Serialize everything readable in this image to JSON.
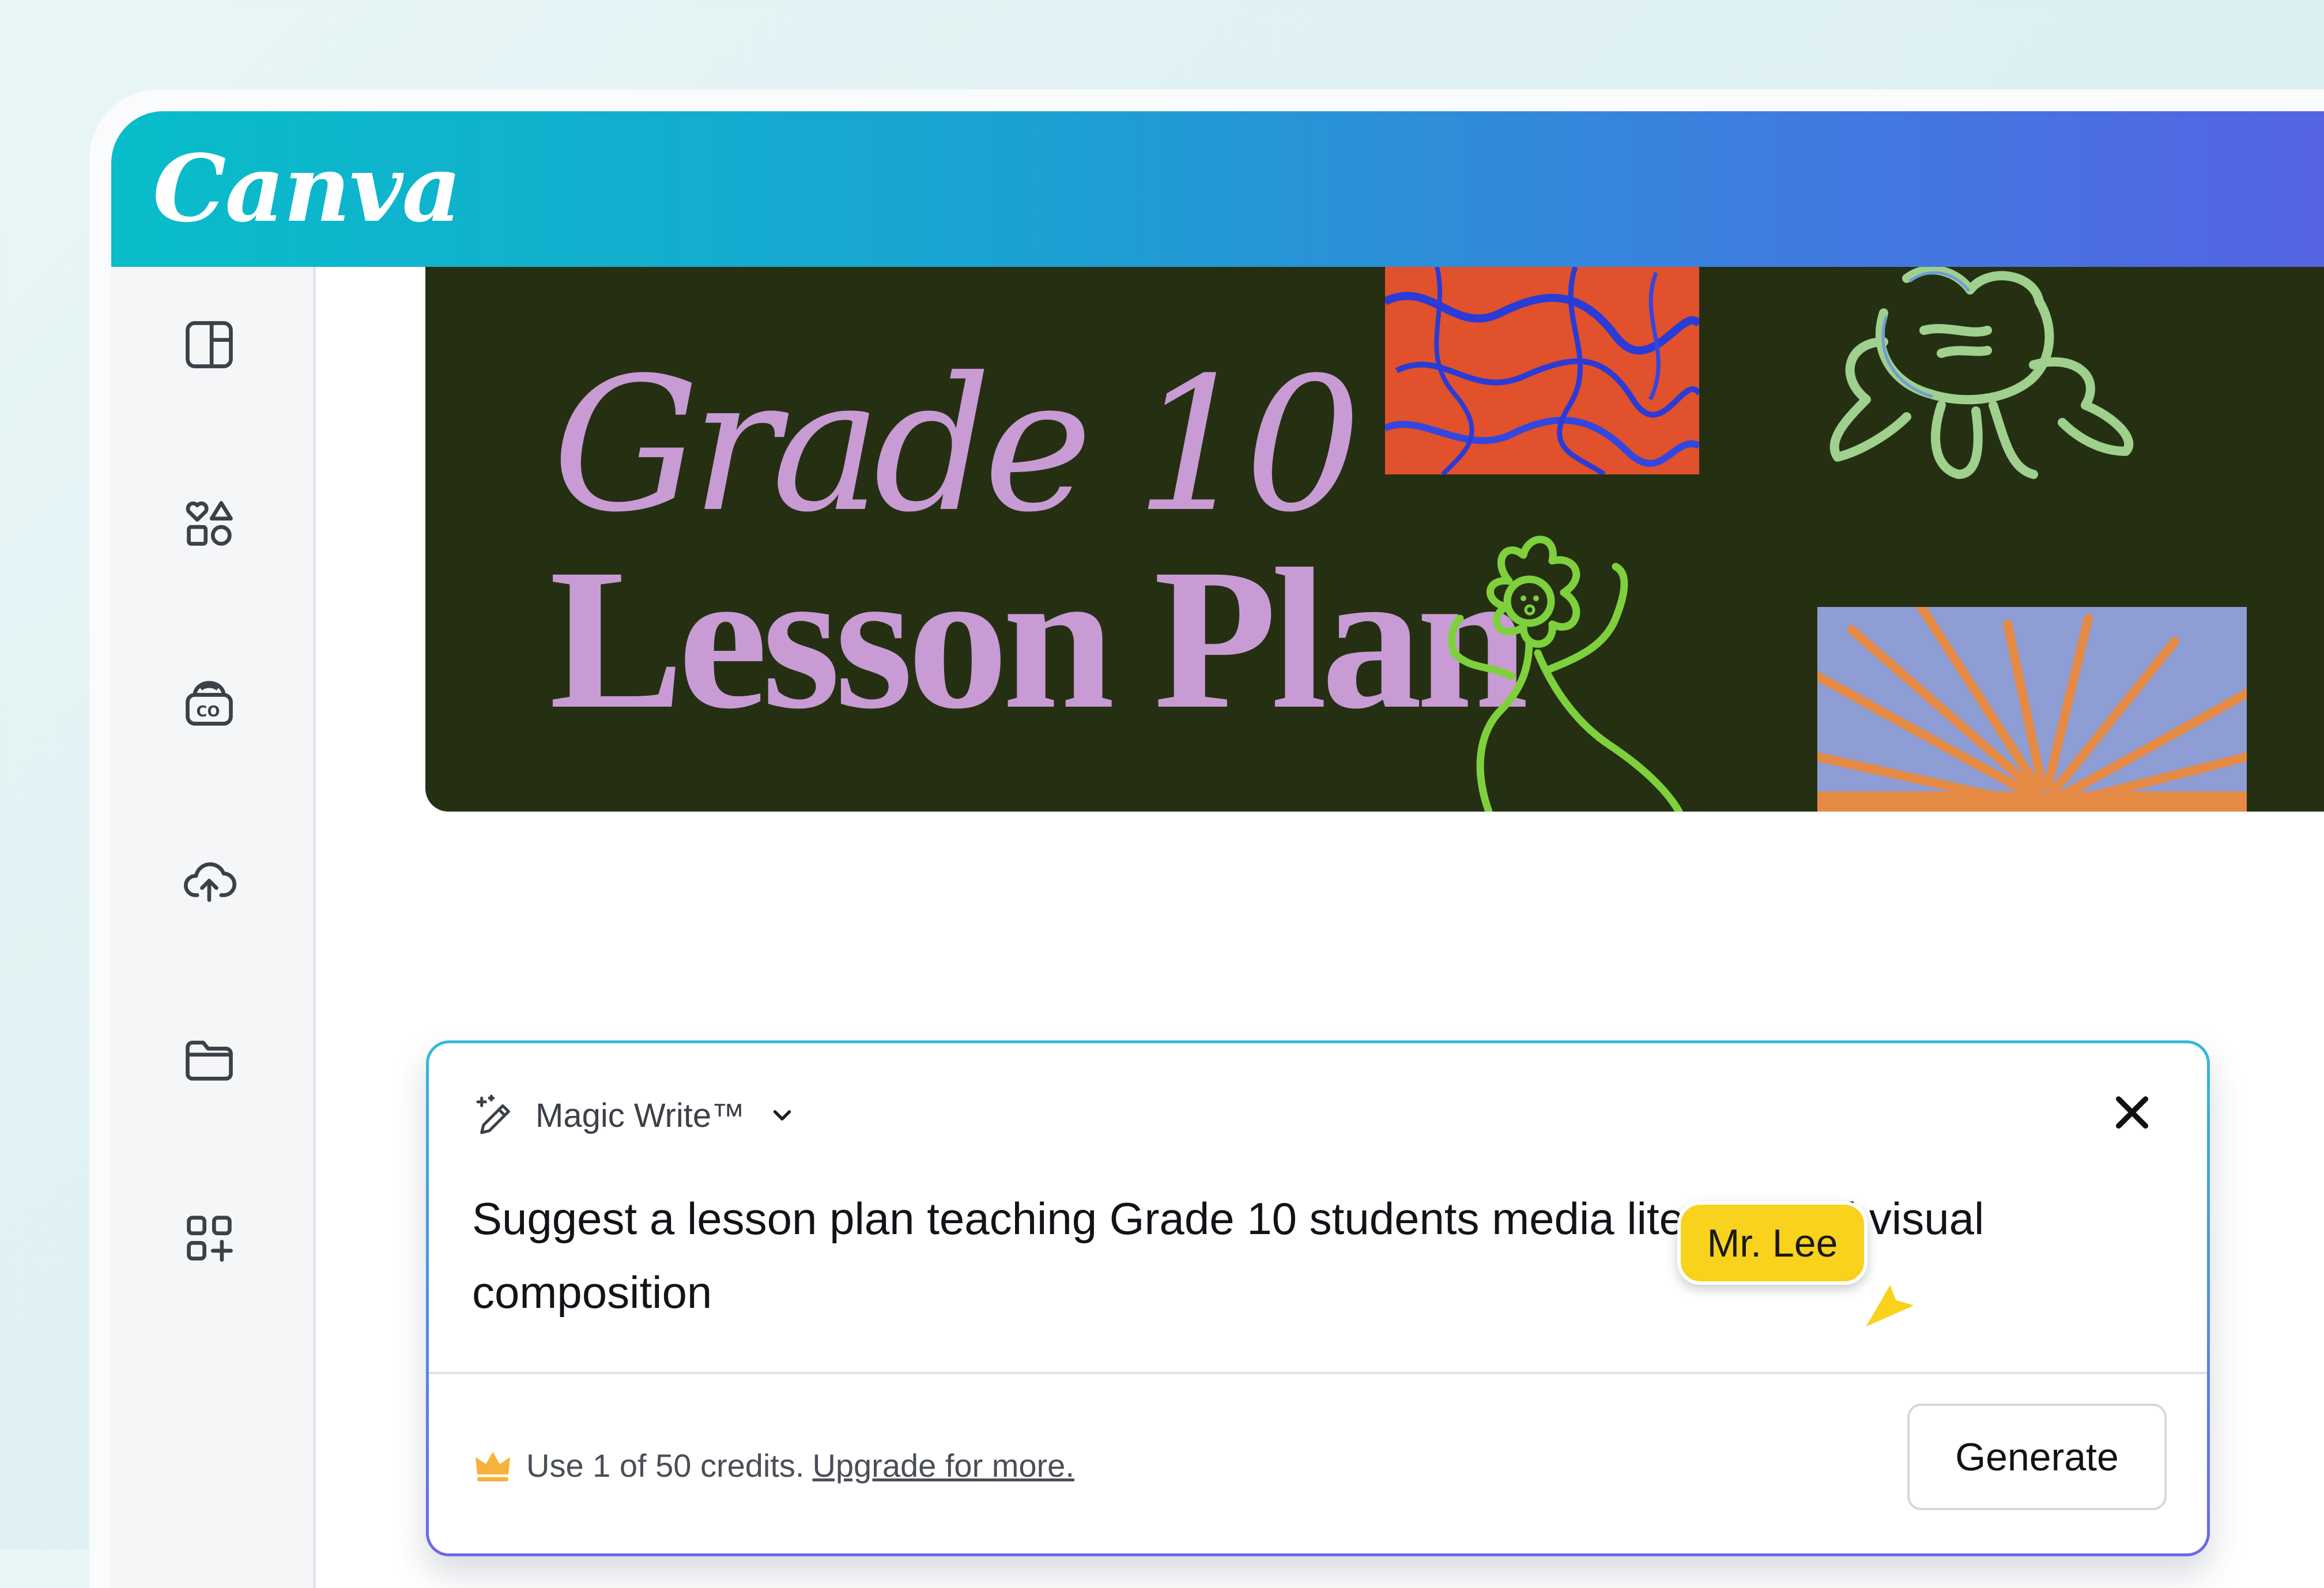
{
  "app": {
    "logo": "Canva"
  },
  "sidebar": {
    "items": [
      {
        "icon": "layout-panel-icon"
      },
      {
        "icon": "elements-shapes-icon"
      },
      {
        "icon": "brand-kit-icon"
      },
      {
        "icon": "upload-cloud-icon"
      },
      {
        "icon": "folder-icon"
      },
      {
        "icon": "apps-add-icon"
      }
    ]
  },
  "design": {
    "title_line1": "Grade 10",
    "title_line2": "Lesson Plan",
    "background_color": "#253013",
    "title_color": "#c99bd4"
  },
  "magic_write": {
    "title": "Magic Write™",
    "prompt": "Suggest a lesson plan teaching Grade 10 students media literacy and visual composition",
    "credits_text": "Use 1 of 50 credits.",
    "upgrade_link": "Upgrade for more.",
    "generate_label": "Generate"
  },
  "collaborator": {
    "name": "Mr. Lee",
    "color": "#f8d21c"
  }
}
